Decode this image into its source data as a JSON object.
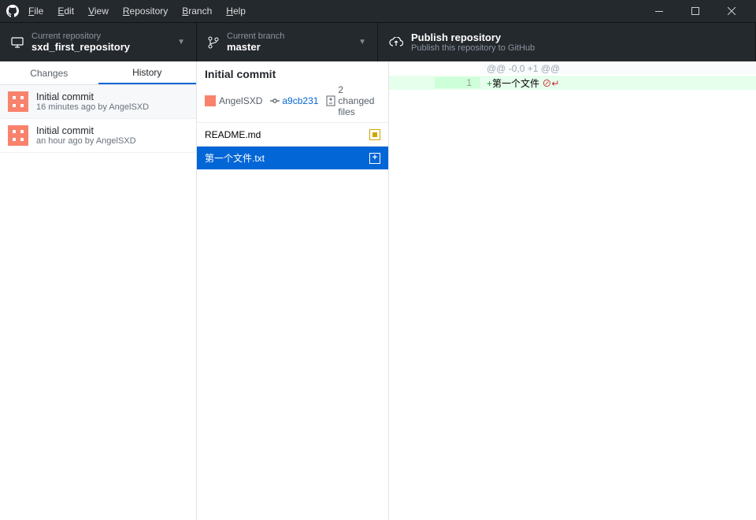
{
  "menu": {
    "file": "File",
    "edit": "Edit",
    "view": "View",
    "repository": "Repository",
    "branch": "Branch",
    "help": "Help"
  },
  "toolbar": {
    "repo": {
      "label": "Current repository",
      "value": "sxd_first_repository"
    },
    "branch": {
      "label": "Current branch",
      "value": "master"
    },
    "publish": {
      "label": "Publish repository",
      "value": "Publish this repository to GitHub"
    }
  },
  "tabs": {
    "changes": "Changes",
    "history": "History"
  },
  "commits": [
    {
      "title": "Initial commit",
      "meta": "16 minutes ago by AngelSXD"
    },
    {
      "title": "Initial commit",
      "meta": "an hour ago by AngelSXD"
    }
  ],
  "detail": {
    "title": "Initial commit",
    "author": "AngelSXD",
    "sha": "a9cb231",
    "changed": "2 changed files",
    "files": [
      {
        "name": "README.md",
        "status": "modified"
      },
      {
        "name": "第一个文件.txt",
        "status": "added"
      }
    ]
  },
  "diff": {
    "hunk": "@@ -0,0 +1 @@",
    "lines": [
      {
        "num": "1",
        "plus": "+",
        "text": "第一个文件",
        "noeol": true
      }
    ]
  }
}
